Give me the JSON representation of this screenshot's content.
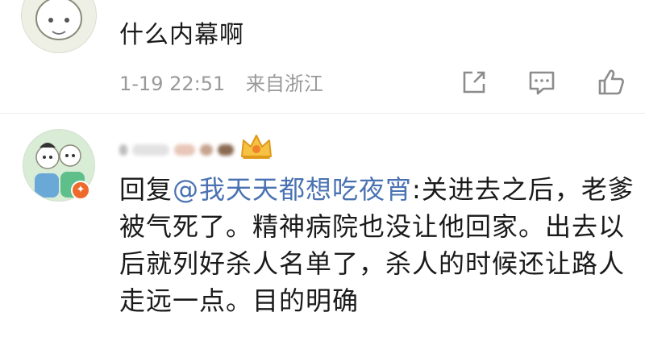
{
  "comments": [
    {
      "text": "什么内幕啊",
      "time": "1-19 22:51",
      "source": "来自浙江"
    },
    {
      "reply_prefix": "回复",
      "mention": "@我天天都想吃夜宵",
      "reply_body": ":关进去之后，老爹被气死了。精神病院也没让他回家。出去以后就列好杀人名单了，杀人的时候还让路人走远一点。目的明确"
    }
  ],
  "colors": {
    "mention": "#4a72b2",
    "meta": "#999999",
    "vip_badge": "#ee6a2c",
    "crown": "#f0a020"
  },
  "icons": [
    "share-icon",
    "comment-icon",
    "like-icon",
    "crown-icon",
    "vip-badge-icon"
  ]
}
